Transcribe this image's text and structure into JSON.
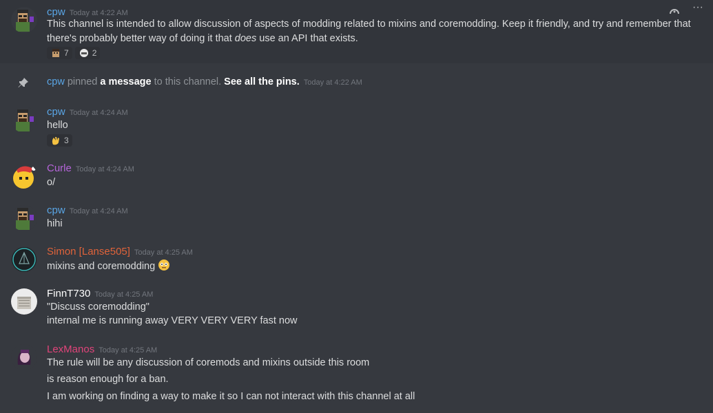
{
  "toolbar": {
    "add_reaction_icon": "add-reaction-icon",
    "more_icon": "more-icon",
    "more_label": "···"
  },
  "colors": {
    "cpw": "#5aa6e6",
    "curle": "#b565d9",
    "simon": "#e0633a",
    "finn": "#ffffff",
    "lexmanos": "#e0447a"
  },
  "messages": [
    {
      "author": "cpw",
      "timestamp": "Today at 4:22 AM",
      "lines": [
        "This channel is intended to allow discussion of aspects of modding related to mixins and coremodding. Keep it friendly, and try and remember that",
        "there's probably better way of doing it that ",
        "does",
        " use an API that exists."
      ],
      "reactions": [
        {
          "emoji": "custom-emoji",
          "count": "7"
        },
        {
          "emoji": "custom-emoji",
          "count": "2"
        }
      ]
    },
    {
      "author": "cpw",
      "timestamp": "Today at 4:24 AM",
      "lines": [
        "hello"
      ],
      "reactions": [
        {
          "emoji": "waving-hand",
          "count": "3"
        }
      ]
    },
    {
      "author": "Curle",
      "timestamp": "Today at 4:24 AM",
      "lines": [
        "o/"
      ]
    },
    {
      "author": "cpw",
      "timestamp": "Today at 4:24 AM",
      "lines": [
        "hihi"
      ]
    },
    {
      "author": "Simon [Lanse505]",
      "timestamp": "Today at 4:25 AM",
      "lines": [
        "mixins and coremodding"
      ]
    },
    {
      "author": "FinnT730",
      "timestamp": "Today at 4:25 AM",
      "lines": [
        "\"Discuss coremodding\"",
        "internal me is running away VERY VERY VERY fast now"
      ]
    },
    {
      "author": "LexManos",
      "timestamp": "Today at 4:25 AM",
      "lines": [
        "The rule will be any discussion of coremods and mixins outside this room",
        "is reason enough for a ban.",
        "I am working on finding a way to make it so I can not interact with this channel at all"
      ]
    }
  ],
  "system": {
    "user": "cpw",
    "text1": " pinned ",
    "link": "a message",
    "text2": " to this channel. ",
    "see_all": "See all the pins.",
    "timestamp": "Today at 4:22 AM"
  }
}
